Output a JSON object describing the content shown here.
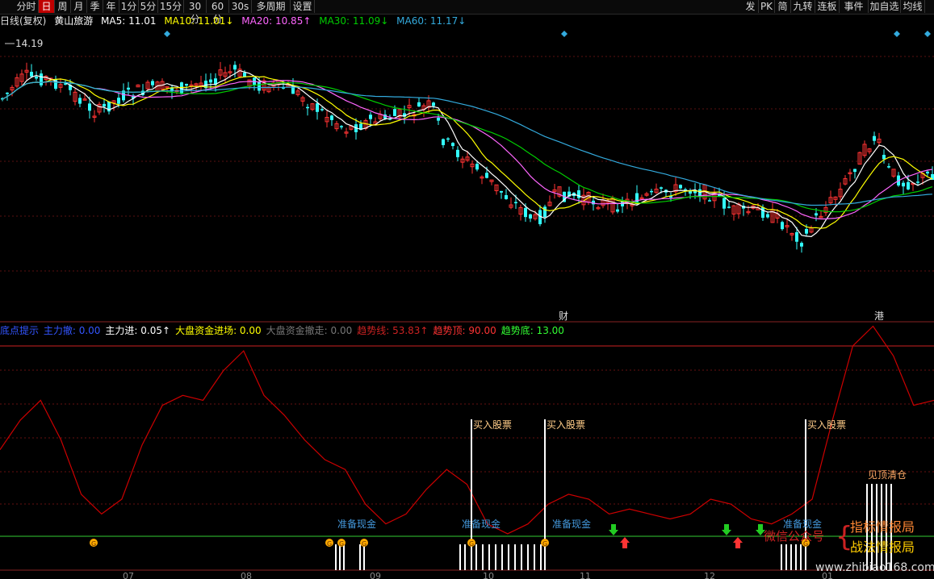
{
  "toolbar": {
    "items": [
      "分时",
      "日",
      "周",
      "月",
      "季",
      "年",
      "1分",
      "5分",
      "15分",
      "30分",
      "60分",
      "30s",
      "多周期",
      "设置"
    ],
    "active": "日",
    "right_items": [
      "发",
      "PK",
      "简",
      "九转",
      "连板",
      "事件",
      "加自选",
      "均线"
    ]
  },
  "main_info": {
    "period_label": "日线(复权)",
    "stock_name": "黄山旅游",
    "ma5": {
      "label": "MA5:",
      "value": "11.01",
      "color": "#ffffff"
    },
    "ma10": {
      "label": "MA10:",
      "value": "11.01",
      "arrow": "↓",
      "color": "#ffff00"
    },
    "ma20": {
      "label": "MA20:",
      "value": "10.85",
      "arrow": "↑",
      "color": "#ff66ff"
    },
    "ma30": {
      "label": "MA30:",
      "value": "11.09",
      "arrow": "↓",
      "color": "#00cc00"
    },
    "ma60": {
      "label": "MA60:",
      "value": "11.17",
      "arrow": "↓",
      "color": "#33aadd"
    },
    "high_price": "14.19",
    "markers": [
      "财",
      "港"
    ]
  },
  "indicator_info": {
    "name": "底点提示",
    "items": [
      {
        "label": "主力撤:",
        "value": "0.00",
        "color": "#3355ff"
      },
      {
        "label": "主力进:",
        "value": "0.05↑",
        "color": "#ffffff"
      },
      {
        "label": "大盘资金进场:",
        "value": "0.00",
        "color": "#ffff00"
      },
      {
        "label": "大盘资金撤走:",
        "value": "0.00",
        "color": "#777777"
      },
      {
        "label": "趋势线:",
        "value": "53.83↑",
        "color": "#cc2222"
      },
      {
        "label": "趋势顶:",
        "value": "90.00",
        "color": "#ff3333"
      },
      {
        "label": "趋势底:",
        "value": "13.00",
        "color": "#33ff33"
      }
    ]
  },
  "annotations": {
    "buy": "买入股票",
    "prepare": "准备现金",
    "top_clear": "见顶清仓",
    "gold_letter": "G",
    "watermark_left": "微信公众号",
    "watermark_brace": "{",
    "watermark_top": "指标情报局",
    "watermark_bottom": "战法情报局",
    "watermark_url": "www.zhibiao168.com"
  },
  "x_axis": {
    "months": [
      "07",
      "08",
      "09",
      "10",
      "11",
      "12",
      "01"
    ]
  },
  "colors": {
    "up": "#ff3333",
    "down": "#33ffff",
    "ma5": "#ffffff",
    "ma10": "#ffff00",
    "ma20": "#ff66ff",
    "ma30": "#00cc00",
    "ma60": "#33aadd",
    "trend": "#cc0000",
    "grid": "#661111"
  },
  "chart_data": {
    "type": "line",
    "title": "日线(复权) 黄山旅游",
    "series": [
      {
        "name": "趋势线",
        "values": [
          48,
          60,
          68,
          52,
          30,
          22,
          28,
          50,
          66,
          70,
          68,
          80,
          88,
          70,
          62,
          52,
          44,
          40,
          26,
          18,
          22,
          32,
          40,
          34,
          18,
          14,
          18,
          26,
          30,
          28,
          22,
          24,
          22,
          20,
          22,
          28,
          26,
          20,
          18,
          22,
          28,
          60,
          90,
          98,
          86,
          66,
          68
        ]
      },
      {
        "name": "趋势顶",
        "values": [
          90
        ]
      },
      {
        "name": "趋势底",
        "values": [
          13
        ]
      }
    ],
    "x": [
      "07",
      "08",
      "09",
      "10",
      "11",
      "12",
      "01"
    ],
    "ylim": [
      0,
      100
    ]
  }
}
